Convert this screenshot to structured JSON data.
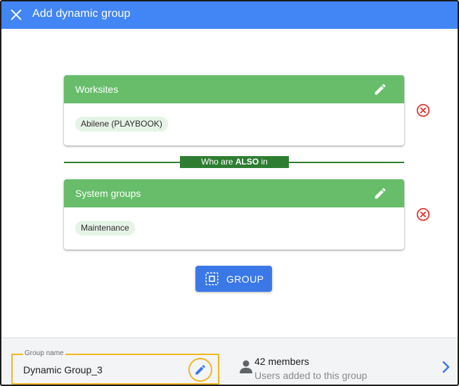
{
  "header": {
    "title": "Add dynamic group",
    "close_icon": "close-icon"
  },
  "colors": {
    "header_bg": "#4285f4",
    "card_header_bg": "#67bd6a",
    "divider": "#2e7d32",
    "remove": "#e53935",
    "primary_button": "#3b78e7",
    "highlight": "#f2b61f"
  },
  "cards": [
    {
      "title": "Worksites",
      "chips": [
        "Abilene (PLAYBOOK)"
      ],
      "edit_icon": "pencil-icon",
      "remove_icon": "remove-circle-icon"
    },
    {
      "title": "System groups",
      "chips": [
        "Maintenance"
      ],
      "edit_icon": "pencil-icon",
      "remove_icon": "remove-circle-icon"
    }
  ],
  "divider": {
    "prefix": "Who are ",
    "emphasis": "ALSO",
    "suffix": " in"
  },
  "group_button": {
    "label": "GROUP",
    "icon": "group-selection-icon"
  },
  "footer": {
    "group_name": {
      "label": "Group name",
      "value": "Dynamic Group_3",
      "edit_icon": "pencil-icon"
    },
    "members": {
      "count_text": "42 members",
      "subtitle": "Users added to this group",
      "icon": "person-icon"
    },
    "next_icon": "chevron-right-icon"
  }
}
